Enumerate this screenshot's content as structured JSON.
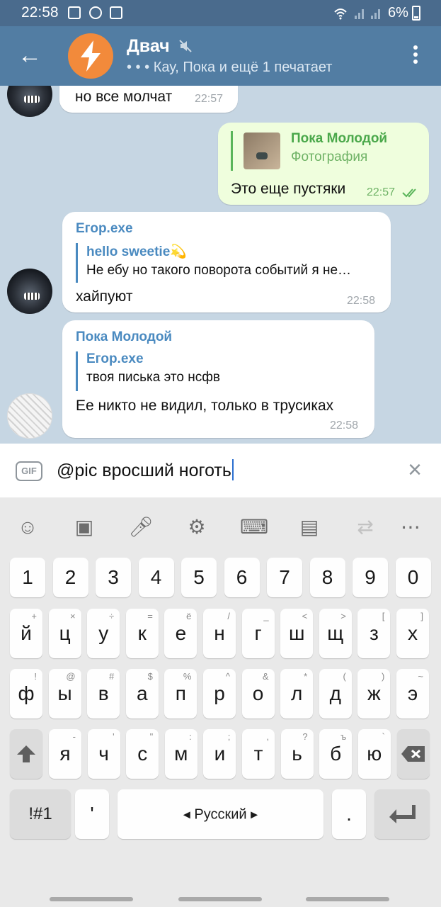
{
  "status_bar": {
    "time": "22:58",
    "battery": "6%"
  },
  "header": {
    "title": "Двач",
    "status": "Кау, Пока и ещё 1 печатает",
    "typing_dots": "• • •"
  },
  "messages": [
    {
      "text": "но все молчат",
      "time": "22:57"
    },
    {
      "reply_name": "Пока Молодой",
      "reply_sub": "Фотография",
      "text": "Это еще пустяки",
      "time": "22:57"
    },
    {
      "sender": "Егор.exe",
      "reply_name": "hello sweetie💫",
      "reply_text": "Не ебу но такого поворота событий я не…",
      "text": "хайпуют",
      "time": "22:58"
    },
    {
      "sender": "Пока Молодой",
      "reply_name": "Егор.exe",
      "reply_text": "твоя писька это нсфв",
      "text": "Ее никто не видил, только в трусиках",
      "time": "22:58"
    }
  ],
  "input": {
    "gif_label": "GIF",
    "value": "@pic вросший ноготь",
    "clear": "×"
  },
  "keyboard": {
    "numbers": [
      "1",
      "2",
      "3",
      "4",
      "5",
      "6",
      "7",
      "8",
      "9",
      "0"
    ],
    "row1": [
      [
        "й",
        "+"
      ],
      [
        "ц",
        "×"
      ],
      [
        "у",
        "÷"
      ],
      [
        "к",
        "="
      ],
      [
        "е",
        "ё"
      ],
      [
        "н",
        "/"
      ],
      [
        "г",
        "_"
      ],
      [
        "ш",
        "<"
      ],
      [
        "щ",
        ">"
      ],
      [
        "з",
        "["
      ],
      [
        "х",
        "]"
      ]
    ],
    "row2": [
      [
        "ф",
        "!"
      ],
      [
        "ы",
        "@"
      ],
      [
        "в",
        "#"
      ],
      [
        "а",
        "$"
      ],
      [
        "п",
        "%"
      ],
      [
        "р",
        "^"
      ],
      [
        "о",
        "&"
      ],
      [
        "л",
        "*"
      ],
      [
        "д",
        "("
      ],
      [
        "ж",
        ")"
      ],
      [
        "э",
        "~"
      ]
    ],
    "row3": [
      [
        "я",
        "-"
      ],
      [
        "ч",
        "'"
      ],
      [
        "с",
        "\""
      ],
      [
        "м",
        ":"
      ],
      [
        "и",
        ";"
      ],
      [
        "т",
        ","
      ],
      [
        "ь",
        "?"
      ],
      [
        "б",
        "ъ"
      ],
      [
        "ю",
        "`"
      ]
    ],
    "sym_label": "!#1",
    "comma": "'",
    "space_label": "◂  Русский  ▸",
    "period": ".",
    "toolbar_icons": [
      "emoji-icon",
      "sticker-icon",
      "mic-icon",
      "settings-icon",
      "keyboard-icon",
      "clipboard-icon",
      "translate-icon",
      "more-icon"
    ]
  }
}
